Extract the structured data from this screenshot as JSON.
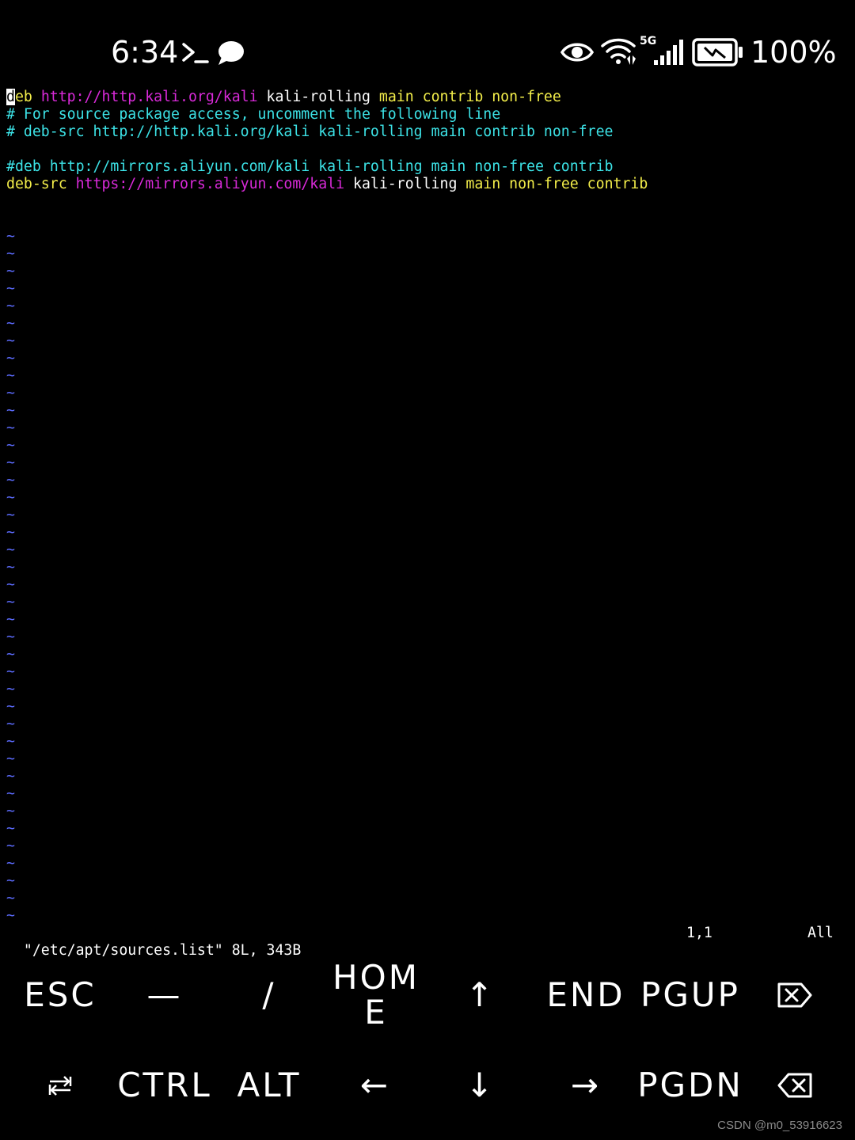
{
  "status_bar": {
    "time": "6:34",
    "icons": [
      "terminal-prompt-icon",
      "chat-bubble-icon",
      "eye-icon",
      "wifi-icon",
      "5g-signal-icon",
      "battery-charging-icon"
    ],
    "network_label": "5G",
    "battery_percent": "100%"
  },
  "editor": {
    "lines": [
      {
        "segments": [
          {
            "text": "d",
            "color": "cursor"
          },
          {
            "text": "eb ",
            "color": "yellow"
          },
          {
            "text": "http://http.kali.org/kali",
            "color": "magenta"
          },
          {
            "text": " kali-rolling ",
            "color": "white"
          },
          {
            "text": "main contrib non-free",
            "color": "yellow"
          }
        ]
      },
      {
        "segments": [
          {
            "text": "# For source package access, uncomment the following line",
            "color": "cyan"
          }
        ]
      },
      {
        "segments": [
          {
            "text": "# deb-src http://http.kali.org/kali kali-rolling main contrib non-free",
            "color": "cyan"
          }
        ]
      },
      {
        "segments": []
      },
      {
        "segments": [
          {
            "text": "#deb http://mirrors.aliyun.com/kali kali-rolling main non-free contrib",
            "color": "cyan"
          }
        ]
      },
      {
        "segments": [
          {
            "text": "deb-src ",
            "color": "yellow"
          },
          {
            "text": "https://mirrors.aliyun.com/kali",
            "color": "magenta"
          },
          {
            "text": " kali-rolling ",
            "color": "white"
          },
          {
            "text": "main non-free contrib",
            "color": "yellow"
          }
        ]
      }
    ],
    "empty_line_marker": "~",
    "empty_line_count": 40,
    "status": {
      "file_info": "\"/etc/apt/sources.list\" 8L, 343B",
      "cursor_position": "1,1",
      "scroll": "All"
    }
  },
  "colors": {
    "background": "#000000",
    "white": "#ffffff",
    "magenta": "#d92ad9",
    "yellow": "#f3ee4a",
    "cyan": "#3ce2e6",
    "tilde": "#5c6cff"
  },
  "extra_keys": {
    "row1": [
      {
        "label": "ESC",
        "name": "esc-key"
      },
      {
        "label": "—",
        "name": "dash-key"
      },
      {
        "label": "/",
        "name": "slash-key"
      },
      {
        "label": "HOME",
        "name": "home-key"
      },
      {
        "label": "↑",
        "name": "up-arrow-key"
      },
      {
        "label": "END",
        "name": "end-key"
      },
      {
        "label": "PGUP",
        "name": "pgup-key"
      },
      {
        "label": "",
        "name": "delete-key",
        "icon": "delete-forward-icon"
      }
    ],
    "row2": [
      {
        "label": "",
        "name": "tab-key",
        "icon": "tab-icon"
      },
      {
        "label": "CTRL",
        "name": "ctrl-key"
      },
      {
        "label": "ALT",
        "name": "alt-key"
      },
      {
        "label": "←",
        "name": "left-arrow-key"
      },
      {
        "label": "↓",
        "name": "down-arrow-key"
      },
      {
        "label": "→",
        "name": "right-arrow-key"
      },
      {
        "label": "PGDN",
        "name": "pgdn-key"
      },
      {
        "label": "",
        "name": "backspace-key",
        "icon": "backspace-icon"
      }
    ]
  },
  "watermark": "CSDN @m0_53916623"
}
